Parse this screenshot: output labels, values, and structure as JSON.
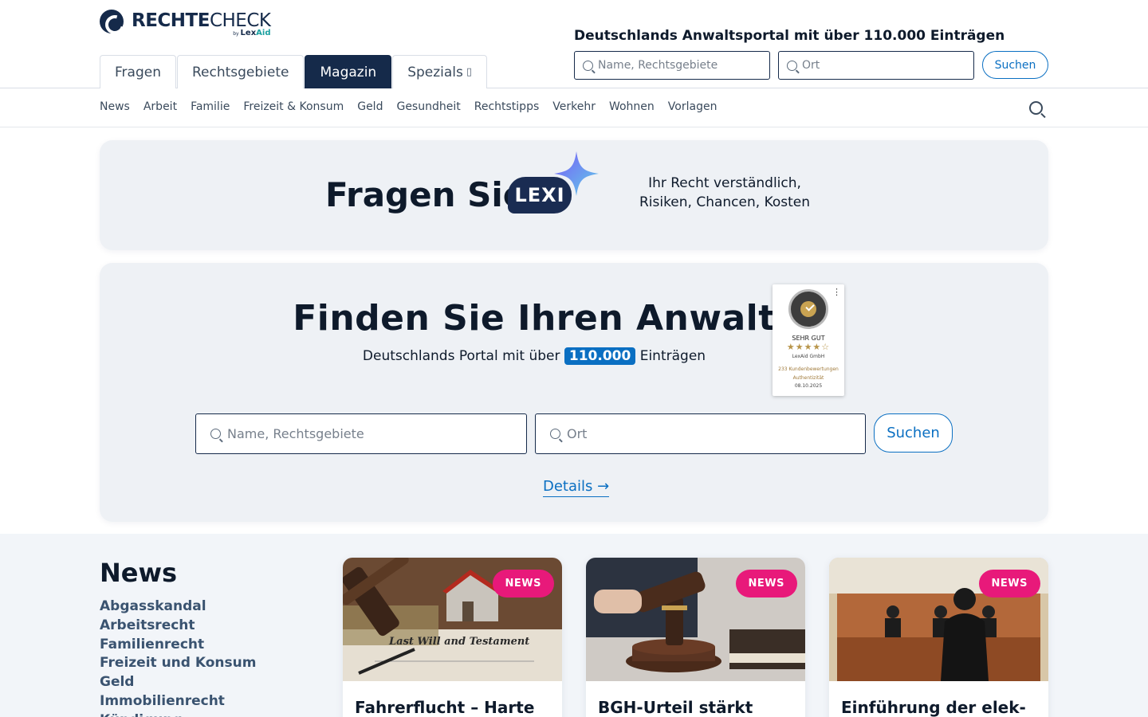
{
  "brand": {
    "name_bold": "RECHTE",
    "name_light": "CHECK",
    "sub_by": "by",
    "sub_lex": "Lex",
    "sub_aid": "Aid"
  },
  "main_tabs": [
    {
      "label": "Fragen"
    },
    {
      "label": "Rechtsgebiete"
    },
    {
      "label": "Magazin",
      "active": true
    },
    {
      "label": "Spezials",
      "caret": "▯"
    }
  ],
  "header_search": {
    "title": "Deutschlands Anwaltsportal mit über 110.000 Einträgen",
    "name_placeholder": "Name, Rechtsgebiete",
    "location_placeholder": "Ort",
    "button_label": "Suchen"
  },
  "subnav": {
    "items": [
      "News",
      "Arbeit",
      "Familie",
      "Freizeit & Konsum",
      "Geld",
      "Gesundheit",
      "Rechtstipps",
      "Verkehr",
      "Wohnen",
      "Vorlagen"
    ],
    "search_icon": "search-icon"
  },
  "lexi": {
    "title": "Fragen Sie",
    "bubble": "LEXI",
    "subtitle_line1": "Ihr Recht verständlich,",
    "subtitle_line2": "Risiken, Chancen, Kosten"
  },
  "finder": {
    "title": "Finden Sie Ihren Anwalt",
    "sub_prefix": "Deutschlands Portal mit über",
    "count": "110.000",
    "sub_suffix": "Einträgen",
    "name_placeholder": "Name, Rechtsgebiete",
    "location_placeholder": "Ort",
    "button_label": "Suchen",
    "details_label": "Details →"
  },
  "proven_expert": {
    "rating": "SEHR GUT",
    "stars": "★★★★☆",
    "company": "LexAid GmbH",
    "reviews": "233 Kundenbewertungen",
    "auth": "Authentizität",
    "date": "08.10.2025",
    "rating_value": 4.5
  },
  "news": {
    "heading": "News",
    "categories": [
      "Abgasskandal",
      "Arbeitsrecht",
      "Familienrecht",
      "Freizeit und Konsum",
      "Geld",
      "Immobilienrecht",
      "Kündigung"
    ],
    "cards": [
      {
        "badge": "NEWS",
        "title": "Fahrerflucht – Harte",
        "image": "gavel-house-testament"
      },
      {
        "badge": "NEWS",
        "title": "BGH-Urteil stärkt",
        "image": "judge-gavel-book"
      },
      {
        "badge": "NEWS",
        "title": "Einführung der elek-",
        "image": "courtroom"
      }
    ]
  },
  "colors": {
    "navy": "#152a4a",
    "accent_blue": "#0a6fc2",
    "news_pink": "#e8197a",
    "card_bg": "#eef1f5"
  }
}
